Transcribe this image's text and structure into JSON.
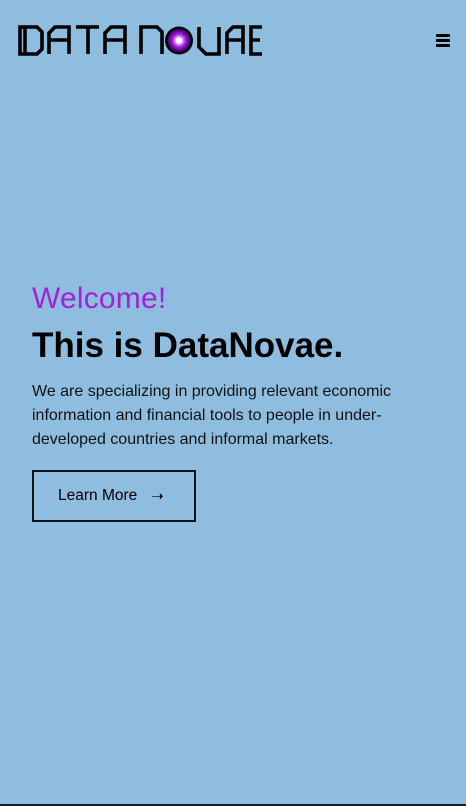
{
  "header": {
    "logo_text": "DATA NOVAE",
    "menu_icon": "hamburger-menu-icon"
  },
  "hero": {
    "welcome": "Welcome!",
    "title": "This is DataNovae.",
    "description": "We are specializing in providing relevant economic information and financial tools to people in under-developed countries and informal markets.",
    "button_label": "Learn More",
    "button_icon": "arrow-right-icon",
    "button_icon_glyph": "➝"
  },
  "colors": {
    "background": "#8fbde0",
    "accent": "#a023d6",
    "text": "#000000"
  }
}
